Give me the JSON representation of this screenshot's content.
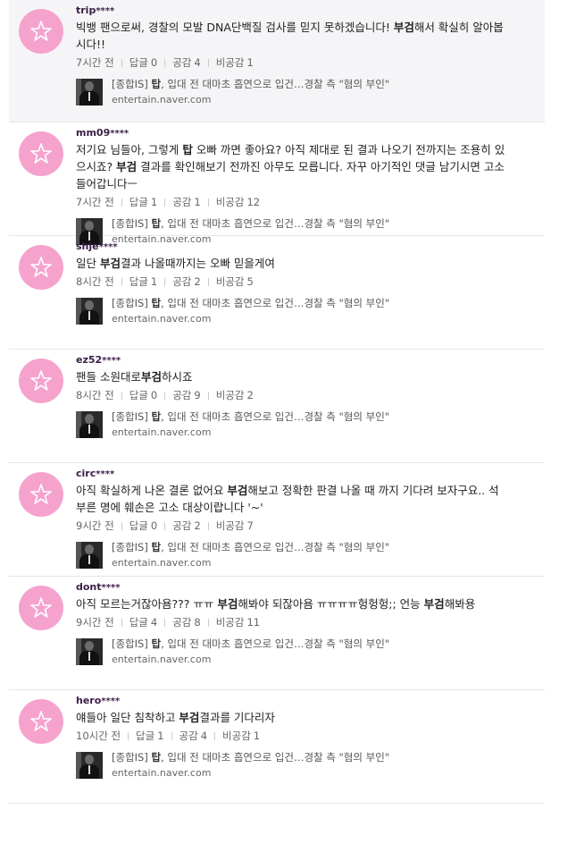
{
  "colors": {
    "avatar": "#f5a3cd",
    "author": "#3a1e46",
    "first_row_bg": "#f5f5f7"
  },
  "comments": [
    {
      "author": "trip",
      "mask": "****",
      "text_html": "빅뱅 팬으로써, 경찰의 모발 DNA단백질 검사를 믿지 못하겠습니다! <b>부검</b>해서 확실히 알아봅<br>시다!!",
      "time": "7시간 전",
      "reply_label": "답글",
      "reply": "0",
      "like_label": "공감",
      "like": "4",
      "dislike_label": "비공감",
      "dislike": "1"
    },
    {
      "author": "mm09",
      "mask": "****",
      "text_html": "저기요 님들아, 그렇게 <b>탑</b> 오빠 까면 좋아요? 아직 제대로 된 결과 나오기 전까지는 조용히 있<br>으시죠? <b>부검</b> 결과를 확인해보기 전까진 아무도 모릅니다. 자꾸 아기적인 댓글 남기시면 고소<br>들어갑니다ㅡ",
      "time": "7시간 전",
      "reply_label": "답글",
      "reply": "1",
      "like_label": "공감",
      "like": "1",
      "dislike_label": "비공감",
      "dislike": "12"
    },
    {
      "author": "shje",
      "mask": "****",
      "text_html": "일단 <b>부검</b>결과 나올때까지는 오빠 믿을게여",
      "time": "8시간 전",
      "reply_label": "답글",
      "reply": "1",
      "like_label": "공감",
      "like": "2",
      "dislike_label": "비공감",
      "dislike": "5"
    },
    {
      "author": "ez52",
      "mask": "****",
      "text_html": "팬들 소원대로<b>부검</b>하시죠",
      "time": "8시간 전",
      "reply_label": "답글",
      "reply": "0",
      "like_label": "공감",
      "like": "9",
      "dislike_label": "비공감",
      "dislike": "2"
    },
    {
      "author": "circ",
      "mask": "****",
      "text_html": "아직 확실하게 나온 결론 없어요 <b>부검</b>해보고 정확한 판결 나올 때 까지 기다려 보자구요.. 석<br>부른 명에 훼손은 고소 대상이랍니다 '~'",
      "time": "9시간 전",
      "reply_label": "답글",
      "reply": "0",
      "like_label": "공감",
      "like": "2",
      "dislike_label": "비공감",
      "dislike": "7"
    },
    {
      "author": "dont",
      "mask": "****",
      "text_html": "아직 모르는거잖아욤??? ㅠㅠ <b>부검</b>해봐야 되잖아욤 ㅠㅠㅠㅠ헝헝헝;; 언능 <b>부검</b>해봐용",
      "time": "9시간 전",
      "reply_label": "답글",
      "reply": "4",
      "like_label": "공감",
      "like": "8",
      "dislike_label": "비공감",
      "dislike": "11"
    },
    {
      "author": "hero",
      "mask": "****",
      "text_html": "얘들아 일단 침착하고 <b>부검</b>결과를 기다리자",
      "time": "10시간 전",
      "reply_label": "답글",
      "reply": "1",
      "like_label": "공감",
      "like": "4",
      "dislike_label": "비공감",
      "dislike": "1"
    }
  ],
  "news_link": {
    "title_prefix": "[종합IS] ",
    "title_bold": "탑",
    "title_rest": ", 입대 전 대마초 흡연으로 입건…경찰 측 \"혐의 부인\"",
    "url": "entertain.naver.com"
  }
}
